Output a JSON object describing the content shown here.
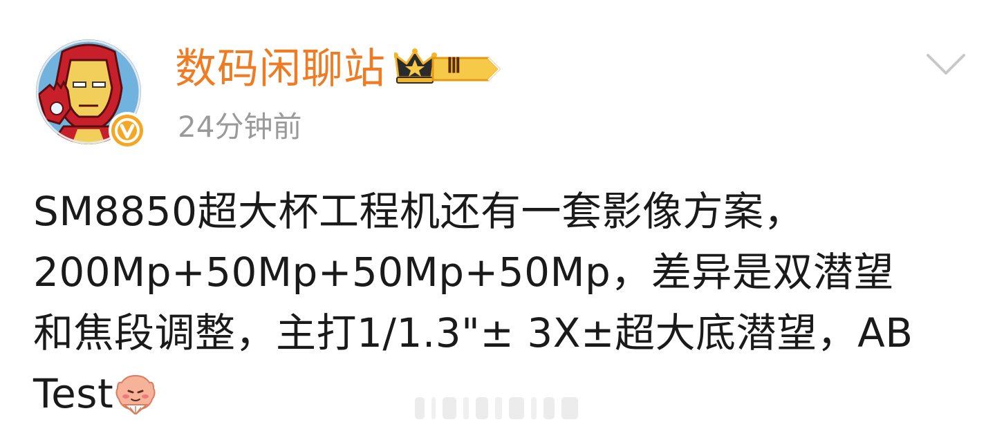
{
  "post": {
    "author": {
      "name": "数码闲聊站",
      "level_badge": "Ⅲ",
      "verified_mark": "V"
    },
    "timestamp": "24分钟前",
    "body_lines": [
      "SM8850超大杯工程机还有一套影像方案，",
      "200Mp+50Mp+50Mp+50Mp，差异是双潜望",
      "和焦段调整，主打1/1.3\"± 3X±超大底潜望，AB",
      "Test"
    ]
  },
  "colors": {
    "username": "#ef7b23",
    "timestamp": "#9a9a9a",
    "body_text": "#1a1a1a",
    "verified": "#f5a623",
    "chevron": "#c8c8c8"
  },
  "icons": {
    "avatar": "iron-man-avatar",
    "verified": "verified-v-icon",
    "level": "crown-level-icon",
    "menu": "chevron-down-icon",
    "emoji": "shy-face-emoji"
  }
}
